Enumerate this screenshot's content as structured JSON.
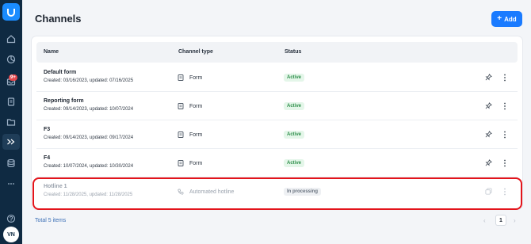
{
  "page": {
    "title": "Channels",
    "add_label": "Add",
    "total": "Total 5 items",
    "current_page": "1"
  },
  "sidebar": {
    "badge": "9+",
    "avatar": "VN",
    "icons": [
      "logo",
      "home-icon",
      "chart-icon",
      "inbox-icon",
      "clipboard-icon",
      "folder-icon",
      "channels-icon",
      "database-icon",
      "more-icon",
      "help-icon"
    ]
  },
  "table": {
    "headers": [
      "Name",
      "Channel type",
      "Status"
    ],
    "rows": [
      {
        "name": "Default form",
        "meta": "Created: 03/16/2023, updated: 07/16/2025",
        "type": "Form",
        "status": "Active"
      },
      {
        "name": "Reporting form",
        "meta": "Created: 09/14/2023, updated: 10/07/2024",
        "type": "Form",
        "status": "Active"
      },
      {
        "name": "F3",
        "meta": "Created: 09/14/2023, updated: 09/17/2024",
        "type": "Form",
        "status": "Active"
      },
      {
        "name": "F4",
        "meta": "Created: 10/07/2024, updated: 10/30/2024",
        "type": "Form",
        "status": "Active"
      },
      {
        "name": "Hotline 1",
        "meta": "Created: 11/28/2025, updated: 11/28/2025",
        "type": "Automated hotline",
        "status": "In processing"
      }
    ]
  },
  "colors": {
    "accent": "#1a7bff",
    "sidebar": "#0f2a42",
    "active_status": "#2f8f4b",
    "highlight": "#e3141b"
  }
}
